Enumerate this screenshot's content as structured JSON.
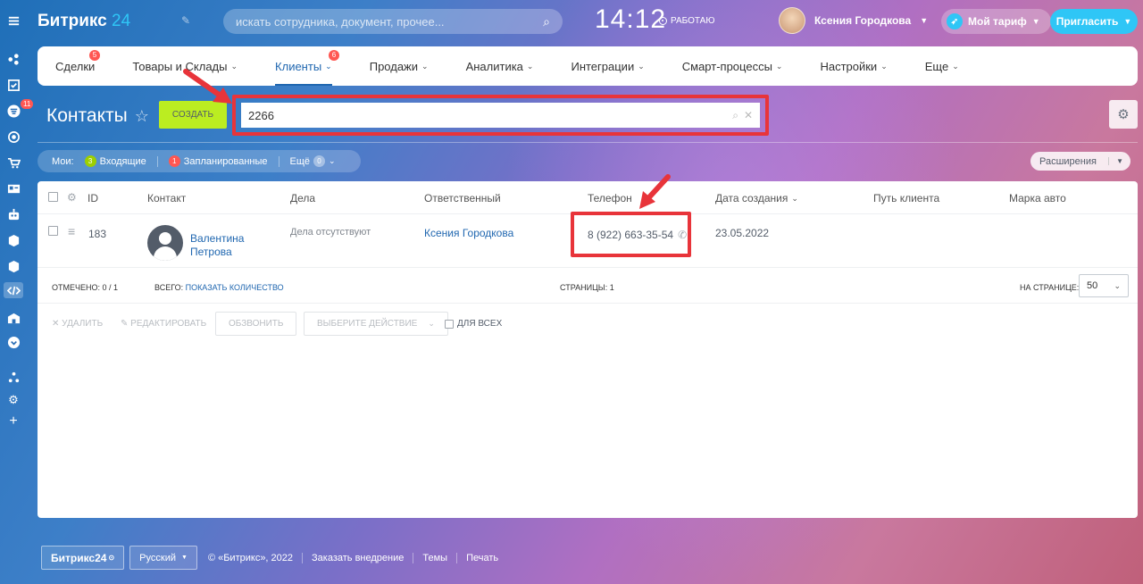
{
  "header": {
    "logo_main": "Битрикс",
    "logo_num": "24",
    "search_placeholder": "искать сотрудника, документ, прочее...",
    "clock": "14:12",
    "work_status": "РАБОТАЮ",
    "user_name": "Ксения Городкова",
    "tariff_label": "Мой тариф",
    "invite_label": "Пригласить"
  },
  "sidebar": {
    "badge_count": "11",
    "icons": [
      "menu-icon",
      "feed-icon",
      "tasks-icon",
      "crm-icon",
      "target-icon",
      "shop-icon",
      "contact-card-icon",
      "robot-icon",
      "box-icon",
      "box-icon",
      "code-icon",
      "store-icon",
      "chevron-down-icon",
      "sitemap-icon",
      "gear-icon",
      "plus-icon"
    ]
  },
  "menu": {
    "items": [
      {
        "label": "Сделки",
        "badge": "5"
      },
      {
        "label": "Товары и Склады"
      },
      {
        "label": "Клиенты",
        "badge": "6",
        "active": true
      },
      {
        "label": "Продажи"
      },
      {
        "label": "Аналитика"
      },
      {
        "label": "Интеграции"
      },
      {
        "label": "Смарт-процессы"
      },
      {
        "label": "Настройки"
      },
      {
        "label": "Еще"
      }
    ]
  },
  "page": {
    "title": "Контакты",
    "create_label": "СОЗДАТЬ",
    "filter_value": "2266"
  },
  "counters": {
    "my_label": "Мои:",
    "incoming_count": "3",
    "incoming_label": "Входящие",
    "planned_count": "1",
    "planned_label": "Запланированные",
    "more_label": "Ещё",
    "more_count": "0",
    "extensions_label": "Расширения"
  },
  "grid": {
    "columns": {
      "id": "ID",
      "contact": "Контакт",
      "activities": "Дела",
      "responsible": "Ответственный",
      "phone": "Телефон",
      "created": "Дата создания",
      "client_path": "Путь клиента",
      "car_brand": "Марка авто"
    },
    "row": {
      "id": "183",
      "contact_first": "Валентина",
      "contact_last": "Петрова",
      "activities": "Дела отсутствуют",
      "responsible": "Ксения Городкова",
      "phone": "8 (922) 663-35-54",
      "created": "23.05.2022"
    },
    "footer": {
      "marked": "ОТМЕЧЕНО: 0 / 1",
      "total_label": "ВСЕГО:",
      "total_link": "ПОКАЗАТЬ КОЛИЧЕСТВО",
      "pages": "СТРАНИЦЫ: 1",
      "per_page_label": "НА СТРАНИЦЕ:",
      "per_page_value": "50"
    },
    "actions": {
      "delete": "УДАЛИТЬ",
      "edit": "РЕДАКТИРОВАТЬ",
      "call": "ОБЗВОНИТЬ",
      "choose": "ВЫБЕРИТЕ ДЕЙСТВИЕ",
      "for_all": "ДЛЯ ВСЕХ"
    }
  },
  "footer": {
    "brand": "Битрикс24",
    "language": "Русский",
    "copyright": "© «Битрикс», 2022",
    "order": "Заказать внедрение",
    "themes": "Темы",
    "print": "Печать"
  },
  "colors": {
    "accent": "#2fc6f6",
    "create_button": "#bbed21",
    "highlight": "#e8343a",
    "badge": "#ff5752",
    "link": "#2067b0"
  }
}
